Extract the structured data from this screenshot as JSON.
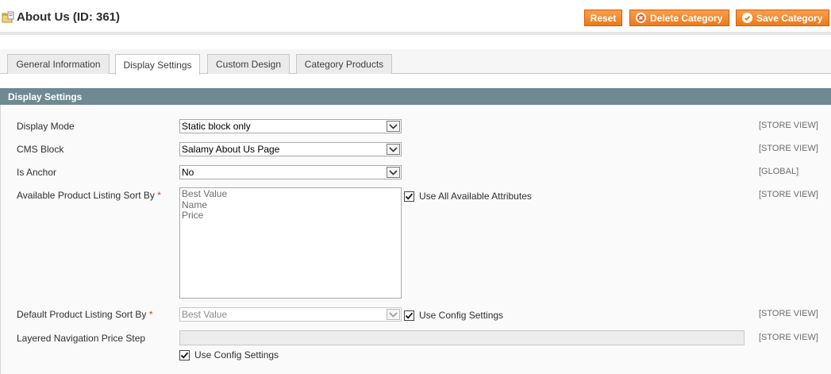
{
  "header": {
    "title": "About Us (ID: 361)",
    "buttons": {
      "reset": "Reset",
      "delete": "Delete Category",
      "save": "Save Category"
    }
  },
  "tabs": [
    {
      "label": "General Information",
      "active": false
    },
    {
      "label": "Display Settings",
      "active": true
    },
    {
      "label": "Custom Design",
      "active": false
    },
    {
      "label": "Category Products",
      "active": false
    }
  ],
  "section": {
    "title": "Display Settings"
  },
  "fields": {
    "display_mode": {
      "label": "Display Mode",
      "value": "Static block only",
      "scope": "[STORE VIEW]"
    },
    "cms_block": {
      "label": "CMS Block",
      "value": "Salamy About Us Page",
      "scope": "[STORE VIEW]"
    },
    "is_anchor": {
      "label": "Is Anchor",
      "value": "No",
      "scope": "[GLOBAL]"
    },
    "available_sort_by": {
      "label": "Available Product Listing Sort By",
      "required_mark": "*",
      "options": [
        "Best Value",
        "Name",
        "Price"
      ],
      "checkbox_label": "Use All Available Attributes",
      "checked": true,
      "scope": "[STORE VIEW]"
    },
    "default_sort_by": {
      "label": "Default Product Listing Sort By",
      "required_mark": "*",
      "value": "Best Value",
      "checkbox_label": "Use Config Settings",
      "checked": true,
      "scope": "[STORE VIEW]"
    },
    "price_step": {
      "label": "Layered Navigation Price Step",
      "value": "",
      "checkbox_label": "Use Config Settings",
      "checked": true,
      "scope": "[STORE VIEW]"
    }
  },
  "icons": {
    "title_icon": "folder-icon",
    "delete_icon": "delete-icon",
    "save_icon": "check-icon",
    "dropdown_icon": "chevron-down-icon",
    "checkbox_icon": "checkmark-icon"
  },
  "colors": {
    "button_orange": "#f0781e",
    "section_bar": "#6f8992",
    "required": "#eb340a"
  }
}
